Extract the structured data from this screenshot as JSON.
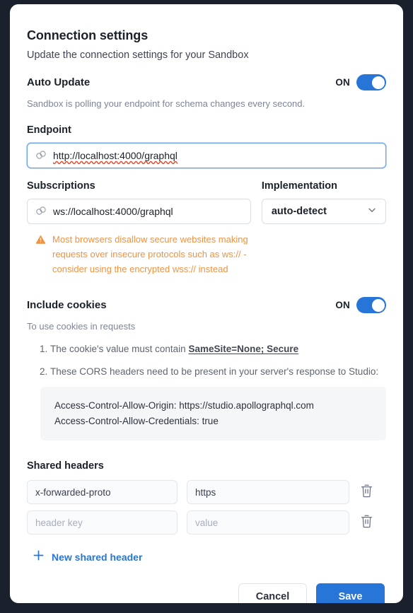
{
  "dialog": {
    "title": "Connection settings",
    "subtitle": "Update the connection settings for your Sandbox"
  },
  "auto_update": {
    "label": "Auto Update",
    "toggle_state": "ON",
    "helper": "Sandbox is polling your endpoint for schema changes every second."
  },
  "endpoint": {
    "label": "Endpoint",
    "value": "http://localhost:4000/graphql",
    "icon": "link-icon"
  },
  "subscriptions": {
    "label": "Subscriptions",
    "value": "ws://localhost:4000/graphql",
    "icon": "link-icon"
  },
  "implementation": {
    "label": "Implementation",
    "selected": "auto-detect"
  },
  "warning": {
    "icon": "warning-triangle-icon",
    "text": "Most browsers disallow secure websites making requests over insecure protocols such as ws:// - consider using the encrypted wss:// instead",
    "color": "#ef9242"
  },
  "cookies": {
    "label": "Include cookies",
    "toggle_state": "ON",
    "helper": "To use cookies in requests",
    "items": [
      {
        "text_before": "The cookie's value must contain ",
        "emphasis": "SameSite=None; Secure"
      },
      {
        "text_before": "These CORS headers need to be present in your server's response to Studio:",
        "emphasis": ""
      }
    ],
    "code_lines": [
      "Access-Control-Allow-Origin: https://studio.apollographql.com",
      "Access-Control-Allow-Credentials: true"
    ]
  },
  "shared_headers": {
    "label": "Shared headers",
    "rows": [
      {
        "key": "x-forwarded-proto",
        "key_placeholder": "header key",
        "value": "https",
        "value_placeholder": "value",
        "filled": true
      },
      {
        "key": "",
        "key_placeholder": "header key",
        "value": "",
        "value_placeholder": "value",
        "filled": false
      }
    ],
    "delete_icon": "trash-icon",
    "add_label": "New shared header",
    "add_icon": "plus-icon"
  },
  "footer": {
    "cancel_label": "Cancel",
    "save_label": "Save"
  },
  "colors": {
    "accent": "#2775d6",
    "warning": "#ef9242",
    "backdrop": "#1b212c"
  }
}
